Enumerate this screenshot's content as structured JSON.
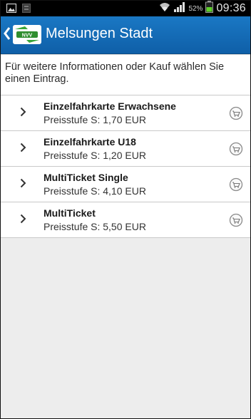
{
  "status_bar": {
    "battery_percent": "52%",
    "time": "09:36",
    "icons": [
      "gallery-icon",
      "notification-icon",
      "wifi-icon",
      "signal-icon",
      "battery-icon"
    ]
  },
  "action_bar": {
    "title": "Melsungen Stadt",
    "logo_text": "NVV",
    "accent": "#1a78c4"
  },
  "hint": "Für weitere Informationen oder Kauf wählen Sie einen Eintrag.",
  "tickets": [
    {
      "title": "Einzelfahrkarte Erwachsene",
      "price": "Preisstufe S: 1,70 EUR"
    },
    {
      "title": "Einzelfahrkarte U18",
      "price": "Preisstufe S: 1,20 EUR"
    },
    {
      "title": "MultiTicket Single",
      "price": "Preisstufe S: 4,10 EUR"
    },
    {
      "title": "MultiTicket",
      "price": "Preisstufe S: 5,50 EUR"
    }
  ]
}
